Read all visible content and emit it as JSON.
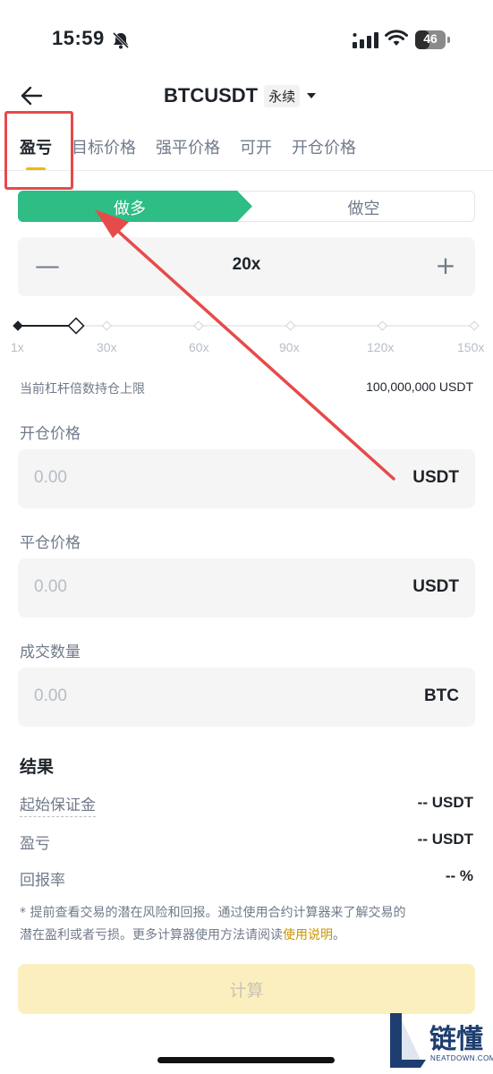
{
  "status_bar": {
    "time": "15:59",
    "battery": "46",
    "battery_level": 0.46
  },
  "header": {
    "title": "BTCUSDT",
    "badge": "永续"
  },
  "tabs": [
    {
      "label": "盈亏",
      "active": true
    },
    {
      "label": "目标价格",
      "active": false
    },
    {
      "label": "强平价格",
      "active": false
    },
    {
      "label": "可开",
      "active": false
    },
    {
      "label": "开仓价格",
      "active": false
    }
  ],
  "side_toggle": {
    "long": "做多",
    "short": "做空",
    "selected": "long"
  },
  "leverage": {
    "value": "20x",
    "minus": "—",
    "plus": "+",
    "current": 20,
    "min": 1,
    "max": 150,
    "ticks": [
      "1x",
      "30x",
      "60x",
      "90x",
      "120x",
      "150x"
    ]
  },
  "position_cap": {
    "label": "当前杠杆倍数持仓上限",
    "value": "100,000,000 USDT"
  },
  "fields": {
    "entry_price": {
      "label": "开仓价格",
      "value": "0.00",
      "unit": "USDT"
    },
    "exit_price": {
      "label": "平仓价格",
      "value": "0.00",
      "unit": "USDT"
    },
    "quantity": {
      "label": "成交数量",
      "value": "0.00",
      "unit": "BTC"
    }
  },
  "result": {
    "title": "结果",
    "rows": [
      {
        "label": "起始保证金",
        "value": "-- USDT"
      },
      {
        "label": "盈亏",
        "value": "-- USDT"
      },
      {
        "label": "回报率",
        "value": "-- %"
      }
    ]
  },
  "note": {
    "text_line1": "* 提前查看交易的潜在风险和回报。通过使用合约计算器来了解交易的",
    "text_line2": "潜在盈利或者亏损。更多计算器使用方法请阅读",
    "link": "使用说明",
    "end": "。"
  },
  "calculate_button": {
    "label": "计算"
  },
  "watermark": {
    "text": "链懂",
    "sub": "NEATDOWN.COM"
  },
  "colors": {
    "long": "#2ebd85",
    "accent": "#f0b90b",
    "annotation": "#e74a4a",
    "button_disabled": "#fcefbf"
  }
}
